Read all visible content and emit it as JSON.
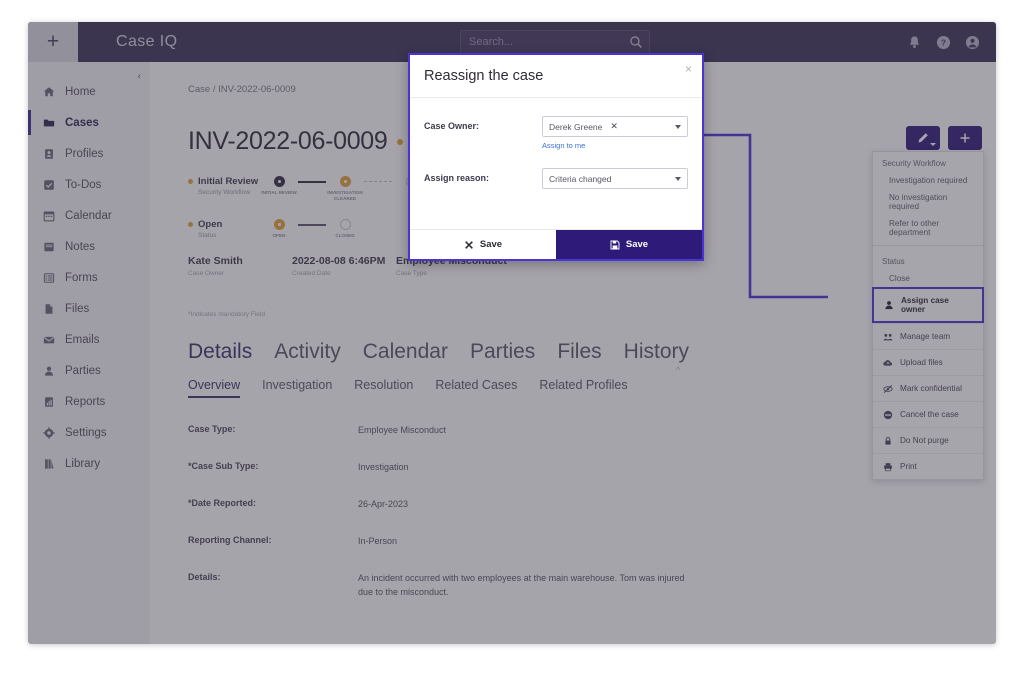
{
  "topbar": {
    "add_label": "+",
    "brand": "Case IQ",
    "search_placeholder": "Search...",
    "search_value": "",
    "icons": [
      "bell-icon",
      "help-icon",
      "account-icon"
    ]
  },
  "sidebar": {
    "collapse_label": "‹",
    "items": [
      {
        "label": "Home",
        "icon": "home-icon",
        "active": false
      },
      {
        "label": "Cases",
        "icon": "folder-icon",
        "active": true
      },
      {
        "label": "Profiles",
        "icon": "profile-icon",
        "active": false
      },
      {
        "label": "To-Dos",
        "icon": "checkbox-icon",
        "active": false
      },
      {
        "label": "Calendar",
        "icon": "calendar-icon",
        "active": false
      },
      {
        "label": "Notes",
        "icon": "notes-icon",
        "active": false
      },
      {
        "label": "Forms",
        "icon": "forms-icon",
        "active": false
      },
      {
        "label": "Files",
        "icon": "file-icon",
        "active": false
      },
      {
        "label": "Emails",
        "icon": "envelope-icon",
        "active": false
      },
      {
        "label": "Parties",
        "icon": "person-icon",
        "active": false
      },
      {
        "label": "Reports",
        "icon": "report-icon",
        "active": false
      },
      {
        "label": "Settings",
        "icon": "gear-icon",
        "active": false
      },
      {
        "label": "Library",
        "icon": "book-icon",
        "active": false
      }
    ]
  },
  "main": {
    "breadcrumb": "Case / INV-2022-06-0009",
    "case_number": "INV-2022-06-0009",
    "mandatory_note": "*Indicates mandatory Field",
    "timelines": [
      {
        "name": "Initial Review",
        "sub": "Security Workflow",
        "nodes": [
          "INITIAL REVIEW",
          "INVESTIGATION CLEARED",
          ""
        ]
      },
      {
        "name": "Open",
        "sub": "Status",
        "nodes": [
          "OPEN",
          "CLOSED"
        ]
      }
    ],
    "meta": [
      {
        "value": "Kate Smith",
        "label": "Case Owner"
      },
      {
        "value": "2022-08-08 6:46PM",
        "label": "Created Date"
      },
      {
        "value": "Employee Misconduct",
        "label": "Case Type"
      }
    ],
    "tabs_primary": [
      {
        "label": "Details",
        "active": true
      },
      {
        "label": "Activity",
        "active": false
      },
      {
        "label": "Calendar",
        "active": false
      },
      {
        "label": "Parties",
        "active": false
      },
      {
        "label": "Files",
        "active": false
      },
      {
        "label": "History",
        "active": false
      }
    ],
    "tabs_secondary": [
      {
        "label": "Overview",
        "active": true
      },
      {
        "label": "Investigation",
        "active": false
      },
      {
        "label": "Resolution",
        "active": false
      },
      {
        "label": "Related Cases",
        "active": false
      },
      {
        "label": "Related Profiles",
        "active": false
      }
    ],
    "fields": [
      {
        "label": "Case Type:",
        "value": "Employee Misconduct"
      },
      {
        "label": "*Case Sub Type:",
        "value": "Investigation"
      },
      {
        "label": "*Date Reported:",
        "value": "26-Apr-2023"
      },
      {
        "label": "Reporting Channel:",
        "value": "In-Person"
      },
      {
        "label": "Details:",
        "value": "An incident occurred with two employees at the main warehouse. Tom was injured due to the misconduct."
      }
    ],
    "actions": [
      {
        "name": "edit-button",
        "icon": "pencil-icon"
      },
      {
        "name": "add-button",
        "icon": "plus-icon"
      }
    ]
  },
  "menu": {
    "section_security": "Security Workflow",
    "security_options": [
      "Investigation required",
      "No investigation required",
      "Refer to other department"
    ],
    "section_status": "Status",
    "status_options": [
      "Close"
    ],
    "items": [
      {
        "label": "Assign case owner",
        "icon": "person-icon",
        "highlight": true
      },
      {
        "label": "Manage team",
        "icon": "team-icon",
        "highlight": false
      },
      {
        "label": "Upload files",
        "icon": "upload-icon",
        "highlight": false
      },
      {
        "label": "Mark confidential",
        "icon": "eye-slash-icon",
        "highlight": false
      },
      {
        "label": "Cancel the case",
        "icon": "ban-icon",
        "highlight": false
      },
      {
        "label": "Do Not purge",
        "icon": "lock-icon",
        "highlight": false
      },
      {
        "label": "Print",
        "icon": "printer-icon",
        "highlight": false
      }
    ]
  },
  "modal": {
    "title": "Reassign the case",
    "close_label": "×",
    "case_owner_label": "Case Owner:",
    "case_owner_value": "Derek Greene",
    "case_owner_clear": "✕",
    "assign_to_me": "Assign to me",
    "assign_reason_label": "Assign reason:",
    "assign_reason_value": "Criteria changed",
    "cancel_label": "Save",
    "save_label": "Save"
  },
  "colors": {
    "brand_purple": "#3d3358",
    "accent_indigo": "#2e1a78",
    "highlight_blue": "#4b34d6",
    "gold": "#e0a33a",
    "link_blue": "#3b6fd4"
  }
}
